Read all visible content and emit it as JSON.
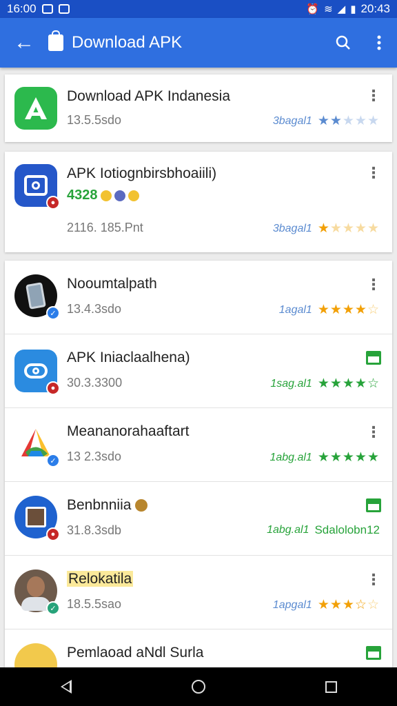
{
  "status_bar": {
    "time": "16:00",
    "clock_right": "20:43"
  },
  "app_bar": {
    "title": "Download APK"
  },
  "apps": [
    {
      "name": "Download APK Indanesia",
      "size": "13.5.5sdo",
      "rating_label": "3bagal1",
      "rating_stars": "★★★★★"
    },
    {
      "name": "APK Iotiognbirsbhoaiili)",
      "score": "4328",
      "size": "2116. 185.Pnt",
      "rating_label": "3bagal1",
      "rating_stars": "★★★★★"
    },
    {
      "name": "Nooumtalpath",
      "size": "13.4.3sdo",
      "rating_label": "1agal1",
      "rating_stars": "★★★★☆"
    },
    {
      "name": "APK Iniaclaalhena)",
      "size": "30.3.3300",
      "rating_label": "1sag.al1",
      "rating_stars": "★★★★☆"
    },
    {
      "name": "Meananorahaaftart",
      "size": "13 2.3sdo",
      "rating_label": "1abg.al1",
      "rating_stars": "★★★★★"
    },
    {
      "name": "Benbnniia",
      "size": "31.8.3sdb",
      "rating_label": "1abg.al1",
      "rating_extra": "Sdalolobn12"
    },
    {
      "name": "Relokatila",
      "size": "18.5.5sao",
      "rating_label": "1apgal1",
      "rating_stars": "★★★★☆"
    },
    {
      "name": "Pemlaoad aNdl Surla"
    }
  ],
  "colors": {
    "primary": "#2f6fe0",
    "status": "#1a4fc4",
    "star_blue": "#5b8bd0",
    "star_gold": "#f2a007",
    "star_green": "#27a33a"
  },
  "nav": {
    "back_icon": "back-icon",
    "home_icon": "home-icon",
    "recents_icon": "recents-icon"
  }
}
